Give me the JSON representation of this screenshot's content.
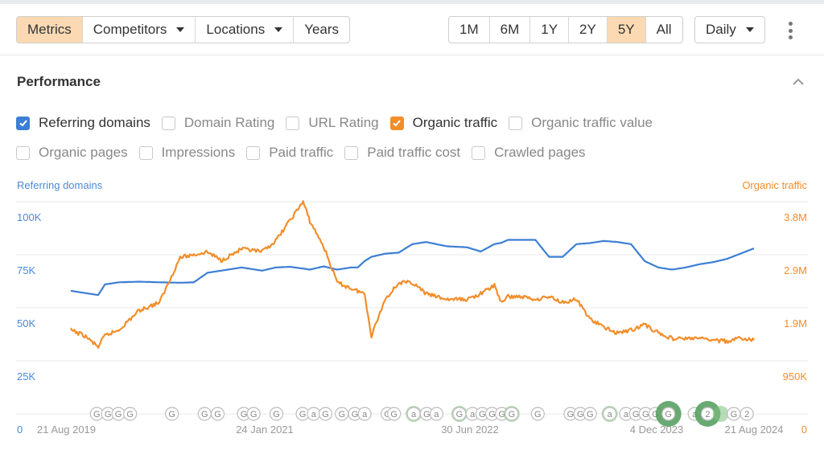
{
  "toolbar": {
    "left_tabs": [
      {
        "label": "Metrics",
        "active": true,
        "dropdown": false
      },
      {
        "label": "Competitors",
        "active": false,
        "dropdown": true
      },
      {
        "label": "Locations",
        "active": false,
        "dropdown": true
      },
      {
        "label": "Years",
        "active": false,
        "dropdown": false
      }
    ],
    "ranges": [
      {
        "label": "1M",
        "active": false
      },
      {
        "label": "6M",
        "active": false
      },
      {
        "label": "1Y",
        "active": false
      },
      {
        "label": "2Y",
        "active": false
      },
      {
        "label": "5Y",
        "active": true
      },
      {
        "label": "All",
        "active": false
      }
    ],
    "interval": "Daily",
    "more_icon": "kebab-menu-icon"
  },
  "section": {
    "title": "Performance",
    "collapse_icon": "chevron-up-icon"
  },
  "metrics_row1": [
    {
      "label": "Referring domains",
      "checked": true,
      "color": "#3c7fd4"
    },
    {
      "label": "Domain Rating",
      "checked": false
    },
    {
      "label": "URL Rating",
      "checked": false
    },
    {
      "label": "Organic traffic",
      "checked": true,
      "color": "#f28e2b"
    },
    {
      "label": "Organic traffic value",
      "checked": false
    }
  ],
  "metrics_row2": [
    {
      "label": "Organic pages",
      "checked": false
    },
    {
      "label": "Impressions",
      "checked": false
    },
    {
      "label": "Paid traffic",
      "checked": false
    },
    {
      "label": "Paid traffic cost",
      "checked": false
    },
    {
      "label": "Crawled pages",
      "checked": false
    }
  ],
  "colors": {
    "referring_domains": "#3c7fd4",
    "organic_traffic": "#f28e2b",
    "active_tab": "#fad9b3",
    "grid": "#e8e8e8",
    "annotation_green": "#7cbf7c"
  },
  "chart_data": {
    "type": "line",
    "title": "Performance",
    "x_tick_labels": [
      "21 Aug 2019",
      "24 Jan 2021",
      "30 Jun 2022",
      "4 Dec 2023",
      "21 Aug 2024"
    ],
    "x_range": [
      "21 Aug 2019",
      "21 Aug 2024"
    ],
    "grid": true,
    "left_axis": {
      "label": "Referring domains",
      "ticks": [
        "100K",
        "75K",
        "50K",
        "25K",
        "0"
      ],
      "range": [
        0,
        100000
      ]
    },
    "right_axis": {
      "label": "Organic traffic",
      "ticks": [
        "3.8M",
        "2.9M",
        "1.9M",
        "950K",
        "0"
      ],
      "range": [
        0,
        3800000
      ]
    },
    "x_fraction": [
      0,
      0.02,
      0.04,
      0.05,
      0.07,
      0.1,
      0.13,
      0.16,
      0.18,
      0.2,
      0.22,
      0.25,
      0.28,
      0.3,
      0.32,
      0.34,
      0.35,
      0.37,
      0.39,
      0.41,
      0.42,
      0.43,
      0.44,
      0.46,
      0.48,
      0.5,
      0.52,
      0.55,
      0.58,
      0.6,
      0.62,
      0.63,
      0.64,
      0.66,
      0.68,
      0.7,
      0.72,
      0.74,
      0.76,
      0.78,
      0.8,
      0.82,
      0.84,
      0.86,
      0.88,
      0.9,
      0.92,
      0.94,
      0.96,
      0.98,
      1.0
    ],
    "series": [
      {
        "name": "Referring domains",
        "axis": "left",
        "values": [
          58000,
          57000,
          56000,
          61000,
          62000,
          62300,
          62000,
          61800,
          62000,
          66500,
          67500,
          69000,
          67500,
          69000,
          69300,
          68500,
          68000,
          69500,
          68000,
          69000,
          69000,
          72000,
          74000,
          75500,
          76000,
          80000,
          81000,
          79000,
          78500,
          76500,
          80000,
          80600,
          82000,
          82000,
          82000,
          74000,
          74000,
          80000,
          80500,
          81500,
          81000,
          80000,
          72000,
          69000,
          68000,
          69000,
          70500,
          71500,
          73000,
          75500,
          78000,
          81000,
          83000
        ]
      },
      {
        "name": "Organic traffic",
        "axis": "right",
        "values": [
          1500000,
          1400000,
          1200000,
          1400000,
          1500000,
          1850000,
          2000000,
          2800000,
          2850000,
          2900000,
          2750000,
          2950000,
          2900000,
          3100000,
          3450000,
          3800000,
          3450000,
          3000000,
          2350000,
          2250000,
          2200000,
          2150000,
          1400000,
          2050000,
          2350000,
          2350000,
          2150000,
          2050000,
          2050000,
          2150000,
          2300000,
          2000000,
          2100000,
          2100000,
          2050000,
          2100000,
          2000000,
          2050000,
          1700000,
          1550000,
          1450000,
          1500000,
          1600000,
          1450000,
          1350000,
          1350000,
          1350000,
          1320000,
          1300000,
          1350000,
          1320000
        ]
      }
    ],
    "annotations": [
      {
        "x": 0.025,
        "label": "G"
      },
      {
        "x": 0.042,
        "label": "G"
      },
      {
        "x": 0.058,
        "label": "G"
      },
      {
        "x": 0.076,
        "label": "G"
      },
      {
        "x": 0.14,
        "label": "G"
      },
      {
        "x": 0.19,
        "label": "G"
      },
      {
        "x": 0.21,
        "label": "G"
      },
      {
        "x": 0.25,
        "label": "G"
      },
      {
        "x": 0.265,
        "label": "G"
      },
      {
        "x": 0.3,
        "label": "G"
      },
      {
        "x": 0.34,
        "label": "G"
      },
      {
        "x": 0.357,
        "label": "a"
      },
      {
        "x": 0.375,
        "label": "G"
      },
      {
        "x": 0.4,
        "label": "G"
      },
      {
        "x": 0.42,
        "label": "G"
      },
      {
        "x": 0.435,
        "label": "a"
      },
      {
        "x": 0.47,
        "label": "G"
      },
      {
        "x": 0.48,
        "label": "G"
      },
      {
        "x": 0.51,
        "label": "a",
        "green": true
      },
      {
        "x": 0.53,
        "label": "G"
      },
      {
        "x": 0.545,
        "label": "a"
      },
      {
        "x": 0.58,
        "label": "G",
        "green": true
      },
      {
        "x": 0.6,
        "label": "a"
      },
      {
        "x": 0.615,
        "label": "G"
      },
      {
        "x": 0.63,
        "label": "G"
      },
      {
        "x": 0.645,
        "label": "G"
      },
      {
        "x": 0.66,
        "label": "G",
        "green": true
      },
      {
        "x": 0.7,
        "label": "G"
      },
      {
        "x": 0.75,
        "label": "G"
      },
      {
        "x": 0.765,
        "label": "G"
      },
      {
        "x": 0.78,
        "label": "G"
      },
      {
        "x": 0.81,
        "label": "a",
        "green": true
      },
      {
        "x": 0.835,
        "label": "a"
      },
      {
        "x": 0.85,
        "label": "G"
      },
      {
        "x": 0.865,
        "label": "G"
      },
      {
        "x": 0.88,
        "label": "G"
      },
      {
        "x": 0.9,
        "label": "G",
        "green": true,
        "big": true
      },
      {
        "x": 0.94,
        "label": "a"
      },
      {
        "x": 0.96,
        "label": "2",
        "green": true,
        "big": true
      },
      {
        "x": 0.98,
        "label": "",
        "green": true
      },
      {
        "x": 1.0,
        "label": "G"
      },
      {
        "x": 1.02,
        "label": "2"
      }
    ]
  }
}
